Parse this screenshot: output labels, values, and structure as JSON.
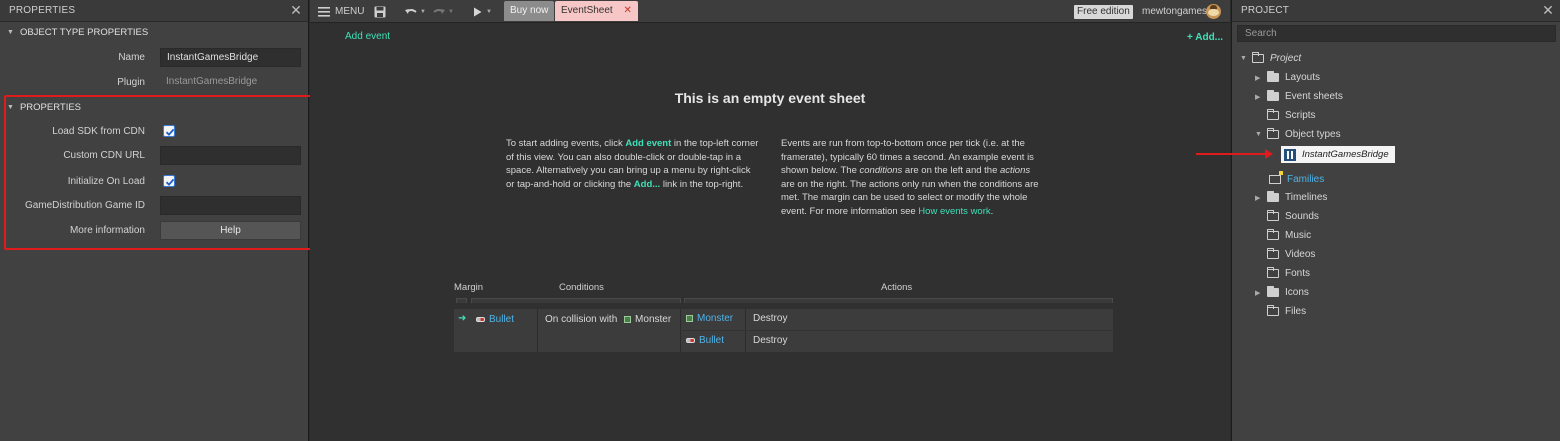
{
  "properties_panel": {
    "title": "PROPERTIES",
    "close": "✕",
    "object_type_section": "OBJECT TYPE PROPERTIES",
    "name_label": "Name",
    "name_value": "InstantGamesBridge",
    "plugin_label": "Plugin",
    "plugin_value": "InstantGamesBridge",
    "properties_section": "PROPERTIES",
    "load_sdk_label": "Load SDK from CDN",
    "load_sdk_checked": true,
    "cdn_url_label": "Custom CDN URL",
    "cdn_url_value": "",
    "init_on_load_label": "Initialize On Load",
    "init_on_load_checked": true,
    "gd_game_id_label": "GameDistribution Game ID",
    "gd_game_id_value": "",
    "more_info_label": "More information",
    "help_button": "Help"
  },
  "toolbar": {
    "menu_label": "MENU",
    "tabs": [
      {
        "label": "Buy now"
      },
      {
        "label": "EventSheet",
        "close": "✕"
      }
    ],
    "edition_badge": "Free edition",
    "username": "mewtongames"
  },
  "event_sheet": {
    "add_event_link": "Add event",
    "add_top_link": "+ Add...",
    "empty_title": "This is an empty event sheet",
    "left_para": {
      "t1": "To start adding events, click ",
      "link1": "Add event",
      "t2": " in the top-left corner of this view. You can also double-click or double-tap in a space. Alternatively you can bring up a menu by right-click or tap-and-hold or clicking the ",
      "link2": "Add...",
      "t3": " link in the top-right."
    },
    "right_para": {
      "t1": "Events are run from top-to-bottom once per tick (i.e. at the framerate), typically 60 times a second. An example event is shown below. The ",
      "em1": "conditions",
      "t2": " are on the left and the ",
      "em2": "actions",
      "t3": " are on the right. The actions only run when the conditions are met. The margin can be used to select or modify the whole event. For more information see ",
      "link": "How events work",
      "t4": "."
    },
    "headers": {
      "margin": "Margin",
      "conditions": "Conditions",
      "actions": "Actions"
    },
    "example": {
      "condition_object": "Bullet",
      "condition_text": "On collision with",
      "condition_target": "Monster",
      "actions": [
        {
          "object": "Monster",
          "action": "Destroy"
        },
        {
          "object": "Bullet",
          "action": "Destroy"
        }
      ]
    }
  },
  "project_panel": {
    "title": "PROJECT",
    "close": "✕",
    "search_placeholder": "Search",
    "root": "Project",
    "items": [
      {
        "label": "Layouts"
      },
      {
        "label": "Event sheets"
      },
      {
        "label": "Scripts"
      },
      {
        "label": "Object types"
      },
      {
        "label": "InstantGamesBridge"
      },
      {
        "label": "Families"
      },
      {
        "label": "Timelines"
      },
      {
        "label": "Sounds"
      },
      {
        "label": "Music"
      },
      {
        "label": "Videos"
      },
      {
        "label": "Fonts"
      },
      {
        "label": "Icons"
      },
      {
        "label": "Files"
      }
    ]
  },
  "colors": {
    "accent_green": "#3ee0b8",
    "object_blue": "#4fb3e8",
    "highlight_red": "#e01b1b"
  }
}
